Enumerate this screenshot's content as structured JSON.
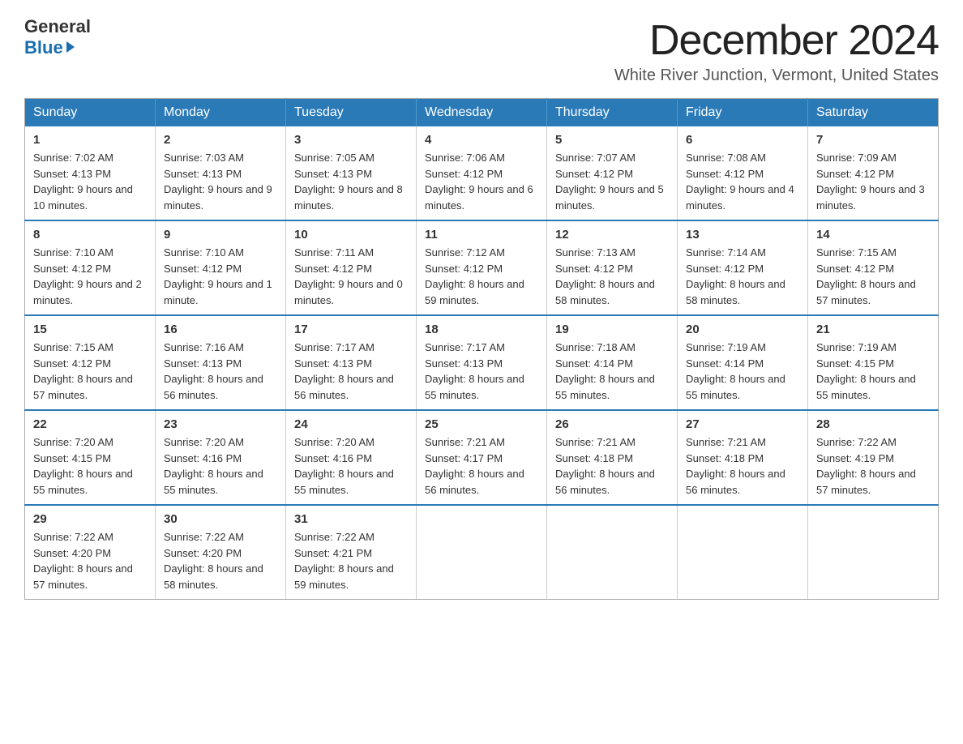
{
  "logo": {
    "general": "General",
    "blue": "Blue"
  },
  "header": {
    "month_year": "December 2024",
    "location": "White River Junction, Vermont, United States"
  },
  "weekdays": [
    "Sunday",
    "Monday",
    "Tuesday",
    "Wednesday",
    "Thursday",
    "Friday",
    "Saturday"
  ],
  "weeks": [
    [
      {
        "day": "1",
        "sunrise": "7:02 AM",
        "sunset": "4:13 PM",
        "daylight": "9 hours and 10 minutes."
      },
      {
        "day": "2",
        "sunrise": "7:03 AM",
        "sunset": "4:13 PM",
        "daylight": "9 hours and 9 minutes."
      },
      {
        "day": "3",
        "sunrise": "7:05 AM",
        "sunset": "4:13 PM",
        "daylight": "9 hours and 8 minutes."
      },
      {
        "day": "4",
        "sunrise": "7:06 AM",
        "sunset": "4:12 PM",
        "daylight": "9 hours and 6 minutes."
      },
      {
        "day": "5",
        "sunrise": "7:07 AM",
        "sunset": "4:12 PM",
        "daylight": "9 hours and 5 minutes."
      },
      {
        "day": "6",
        "sunrise": "7:08 AM",
        "sunset": "4:12 PM",
        "daylight": "9 hours and 4 minutes."
      },
      {
        "day": "7",
        "sunrise": "7:09 AM",
        "sunset": "4:12 PM",
        "daylight": "9 hours and 3 minutes."
      }
    ],
    [
      {
        "day": "8",
        "sunrise": "7:10 AM",
        "sunset": "4:12 PM",
        "daylight": "9 hours and 2 minutes."
      },
      {
        "day": "9",
        "sunrise": "7:10 AM",
        "sunset": "4:12 PM",
        "daylight": "9 hours and 1 minute."
      },
      {
        "day": "10",
        "sunrise": "7:11 AM",
        "sunset": "4:12 PM",
        "daylight": "9 hours and 0 minutes."
      },
      {
        "day": "11",
        "sunrise": "7:12 AM",
        "sunset": "4:12 PM",
        "daylight": "8 hours and 59 minutes."
      },
      {
        "day": "12",
        "sunrise": "7:13 AM",
        "sunset": "4:12 PM",
        "daylight": "8 hours and 58 minutes."
      },
      {
        "day": "13",
        "sunrise": "7:14 AM",
        "sunset": "4:12 PM",
        "daylight": "8 hours and 58 minutes."
      },
      {
        "day": "14",
        "sunrise": "7:15 AM",
        "sunset": "4:12 PM",
        "daylight": "8 hours and 57 minutes."
      }
    ],
    [
      {
        "day": "15",
        "sunrise": "7:15 AM",
        "sunset": "4:12 PM",
        "daylight": "8 hours and 57 minutes."
      },
      {
        "day": "16",
        "sunrise": "7:16 AM",
        "sunset": "4:13 PM",
        "daylight": "8 hours and 56 minutes."
      },
      {
        "day": "17",
        "sunrise": "7:17 AM",
        "sunset": "4:13 PM",
        "daylight": "8 hours and 56 minutes."
      },
      {
        "day": "18",
        "sunrise": "7:17 AM",
        "sunset": "4:13 PM",
        "daylight": "8 hours and 55 minutes."
      },
      {
        "day": "19",
        "sunrise": "7:18 AM",
        "sunset": "4:14 PM",
        "daylight": "8 hours and 55 minutes."
      },
      {
        "day": "20",
        "sunrise": "7:19 AM",
        "sunset": "4:14 PM",
        "daylight": "8 hours and 55 minutes."
      },
      {
        "day": "21",
        "sunrise": "7:19 AM",
        "sunset": "4:15 PM",
        "daylight": "8 hours and 55 minutes."
      }
    ],
    [
      {
        "day": "22",
        "sunrise": "7:20 AM",
        "sunset": "4:15 PM",
        "daylight": "8 hours and 55 minutes."
      },
      {
        "day": "23",
        "sunrise": "7:20 AM",
        "sunset": "4:16 PM",
        "daylight": "8 hours and 55 minutes."
      },
      {
        "day": "24",
        "sunrise": "7:20 AM",
        "sunset": "4:16 PM",
        "daylight": "8 hours and 55 minutes."
      },
      {
        "day": "25",
        "sunrise": "7:21 AM",
        "sunset": "4:17 PM",
        "daylight": "8 hours and 56 minutes."
      },
      {
        "day": "26",
        "sunrise": "7:21 AM",
        "sunset": "4:18 PM",
        "daylight": "8 hours and 56 minutes."
      },
      {
        "day": "27",
        "sunrise": "7:21 AM",
        "sunset": "4:18 PM",
        "daylight": "8 hours and 56 minutes."
      },
      {
        "day": "28",
        "sunrise": "7:22 AM",
        "sunset": "4:19 PM",
        "daylight": "8 hours and 57 minutes."
      }
    ],
    [
      {
        "day": "29",
        "sunrise": "7:22 AM",
        "sunset": "4:20 PM",
        "daylight": "8 hours and 57 minutes."
      },
      {
        "day": "30",
        "sunrise": "7:22 AM",
        "sunset": "4:20 PM",
        "daylight": "8 hours and 58 minutes."
      },
      {
        "day": "31",
        "sunrise": "7:22 AM",
        "sunset": "4:21 PM",
        "daylight": "8 hours and 59 minutes."
      },
      null,
      null,
      null,
      null
    ]
  ],
  "labels": {
    "sunrise": "Sunrise:",
    "sunset": "Sunset:",
    "daylight": "Daylight:"
  }
}
